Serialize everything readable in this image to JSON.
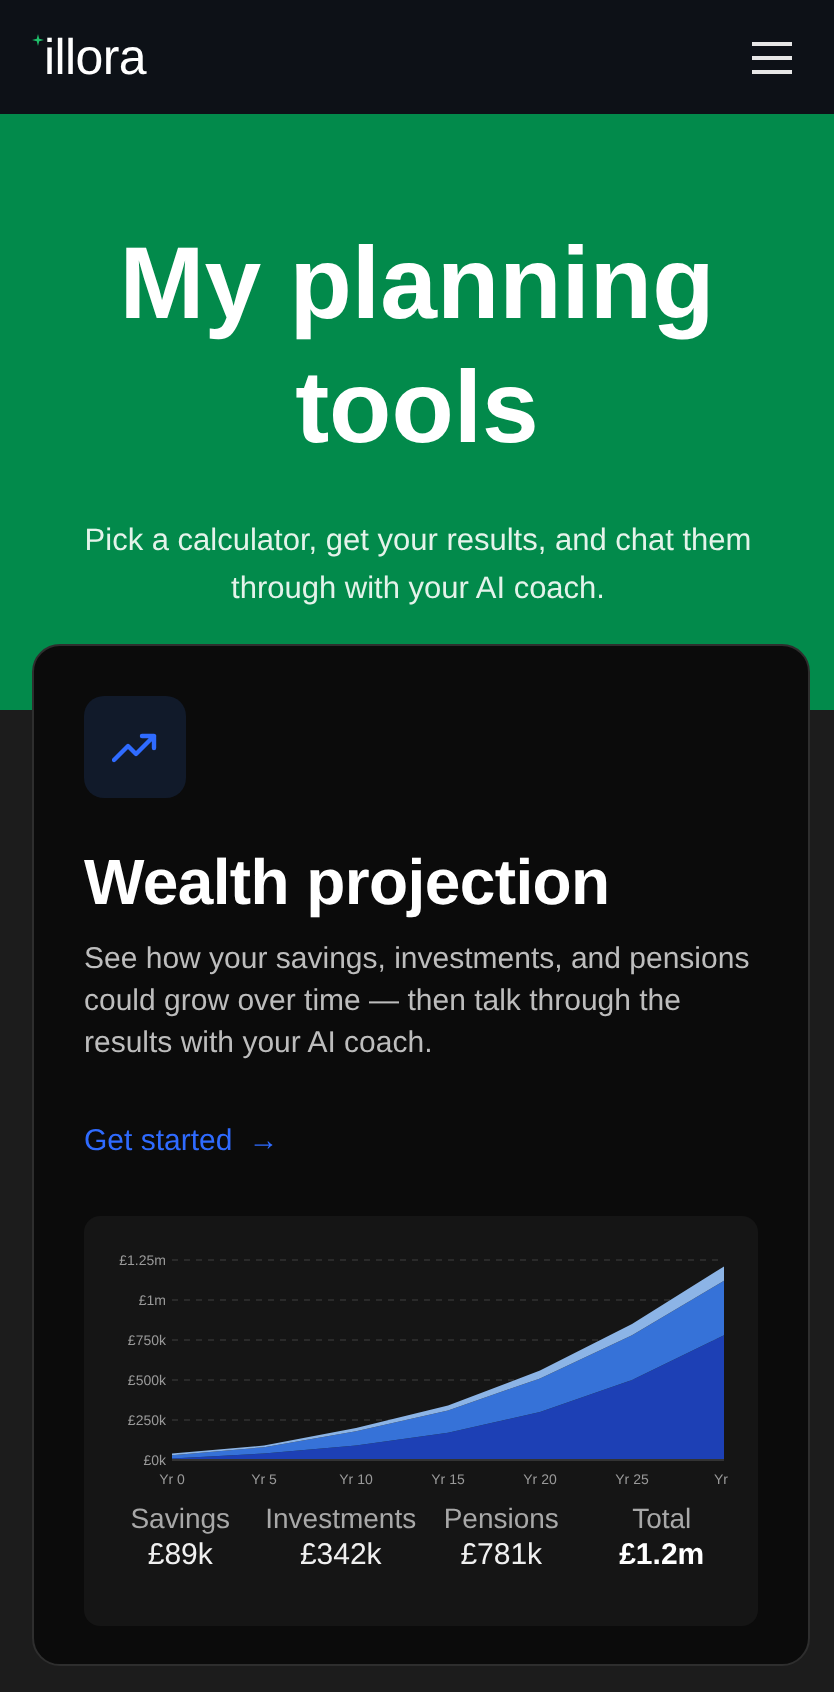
{
  "header": {
    "logo": "illora"
  },
  "hero": {
    "title": "My planning tools",
    "subtitle": "Pick a calculator, get your results, and chat them through with your AI coach."
  },
  "card": {
    "title": "Wealth projection",
    "description": "See how your savings, investments, and pensions could grow over time — then talk through the results with your AI coach.",
    "link": "Get started",
    "link_arrow": "→",
    "chart_data": {
      "type": "area",
      "stacked": true,
      "categories": [
        "Yr 0",
        "Yr 5",
        "Yr 10",
        "Yr 15",
        "Yr 20",
        "Yr 25",
        "Yr"
      ],
      "series": [
        {
          "color": "#1d40b5",
          "values": [
            10000,
            40000,
            90000,
            170000,
            300000,
            500000,
            780000
          ]
        },
        {
          "color": "#3672d8",
          "values": [
            20000,
            40000,
            90000,
            140000,
            210000,
            280000,
            340000
          ]
        },
        {
          "color": "#8cb4e6",
          "values": [
            10000,
            10000,
            20000,
            30000,
            50000,
            70000,
            90000
          ]
        }
      ],
      "ylim": [
        0,
        1250000
      ],
      "grid": true,
      "yticks": [
        {
          "value": 0,
          "label": "£0k"
        },
        {
          "value": 250000,
          "label": "£250k"
        },
        {
          "value": 500000,
          "label": "£500k"
        },
        {
          "value": 750000,
          "label": "£750k"
        },
        {
          "value": 1000000,
          "label": "£1m"
        },
        {
          "value": 1250000,
          "label": "£1.25m"
        }
      ]
    },
    "stats": [
      {
        "kind": "component",
        "label": "Savings",
        "value": "£89k"
      },
      {
        "kind": "component",
        "label": "Investments",
        "value": "£342k"
      },
      {
        "kind": "component",
        "label": "Pensions",
        "value": "£781k"
      },
      {
        "kind": "total",
        "label": "Total",
        "value": "£1.2m"
      }
    ]
  }
}
